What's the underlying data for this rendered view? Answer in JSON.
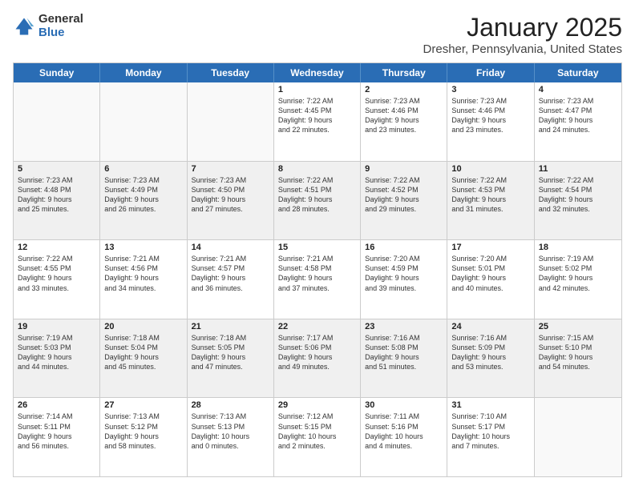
{
  "logo": {
    "general": "General",
    "blue": "Blue"
  },
  "title": "January 2025",
  "location": "Dresher, Pennsylvania, United States",
  "headers": [
    "Sunday",
    "Monday",
    "Tuesday",
    "Wednesday",
    "Thursday",
    "Friday",
    "Saturday"
  ],
  "weeks": [
    [
      {
        "day": "",
        "text": "",
        "empty": true
      },
      {
        "day": "",
        "text": "",
        "empty": true
      },
      {
        "day": "",
        "text": "",
        "empty": true
      },
      {
        "day": "1",
        "text": "Sunrise: 7:22 AM\nSunset: 4:45 PM\nDaylight: 9 hours\nand 22 minutes."
      },
      {
        "day": "2",
        "text": "Sunrise: 7:23 AM\nSunset: 4:46 PM\nDaylight: 9 hours\nand 23 minutes."
      },
      {
        "day": "3",
        "text": "Sunrise: 7:23 AM\nSunset: 4:46 PM\nDaylight: 9 hours\nand 23 minutes."
      },
      {
        "day": "4",
        "text": "Sunrise: 7:23 AM\nSunset: 4:47 PM\nDaylight: 9 hours\nand 24 minutes."
      }
    ],
    [
      {
        "day": "5",
        "text": "Sunrise: 7:23 AM\nSunset: 4:48 PM\nDaylight: 9 hours\nand 25 minutes.",
        "shaded": true
      },
      {
        "day": "6",
        "text": "Sunrise: 7:23 AM\nSunset: 4:49 PM\nDaylight: 9 hours\nand 26 minutes.",
        "shaded": true
      },
      {
        "day": "7",
        "text": "Sunrise: 7:23 AM\nSunset: 4:50 PM\nDaylight: 9 hours\nand 27 minutes.",
        "shaded": true
      },
      {
        "day": "8",
        "text": "Sunrise: 7:22 AM\nSunset: 4:51 PM\nDaylight: 9 hours\nand 28 minutes.",
        "shaded": true
      },
      {
        "day": "9",
        "text": "Sunrise: 7:22 AM\nSunset: 4:52 PM\nDaylight: 9 hours\nand 29 minutes.",
        "shaded": true
      },
      {
        "day": "10",
        "text": "Sunrise: 7:22 AM\nSunset: 4:53 PM\nDaylight: 9 hours\nand 31 minutes.",
        "shaded": true
      },
      {
        "day": "11",
        "text": "Sunrise: 7:22 AM\nSunset: 4:54 PM\nDaylight: 9 hours\nand 32 minutes.",
        "shaded": true
      }
    ],
    [
      {
        "day": "12",
        "text": "Sunrise: 7:22 AM\nSunset: 4:55 PM\nDaylight: 9 hours\nand 33 minutes."
      },
      {
        "day": "13",
        "text": "Sunrise: 7:21 AM\nSunset: 4:56 PM\nDaylight: 9 hours\nand 34 minutes."
      },
      {
        "day": "14",
        "text": "Sunrise: 7:21 AM\nSunset: 4:57 PM\nDaylight: 9 hours\nand 36 minutes."
      },
      {
        "day": "15",
        "text": "Sunrise: 7:21 AM\nSunset: 4:58 PM\nDaylight: 9 hours\nand 37 minutes."
      },
      {
        "day": "16",
        "text": "Sunrise: 7:20 AM\nSunset: 4:59 PM\nDaylight: 9 hours\nand 39 minutes."
      },
      {
        "day": "17",
        "text": "Sunrise: 7:20 AM\nSunset: 5:01 PM\nDaylight: 9 hours\nand 40 minutes."
      },
      {
        "day": "18",
        "text": "Sunrise: 7:19 AM\nSunset: 5:02 PM\nDaylight: 9 hours\nand 42 minutes."
      }
    ],
    [
      {
        "day": "19",
        "text": "Sunrise: 7:19 AM\nSunset: 5:03 PM\nDaylight: 9 hours\nand 44 minutes.",
        "shaded": true
      },
      {
        "day": "20",
        "text": "Sunrise: 7:18 AM\nSunset: 5:04 PM\nDaylight: 9 hours\nand 45 minutes.",
        "shaded": true
      },
      {
        "day": "21",
        "text": "Sunrise: 7:18 AM\nSunset: 5:05 PM\nDaylight: 9 hours\nand 47 minutes.",
        "shaded": true
      },
      {
        "day": "22",
        "text": "Sunrise: 7:17 AM\nSunset: 5:06 PM\nDaylight: 9 hours\nand 49 minutes.",
        "shaded": true
      },
      {
        "day": "23",
        "text": "Sunrise: 7:16 AM\nSunset: 5:08 PM\nDaylight: 9 hours\nand 51 minutes.",
        "shaded": true
      },
      {
        "day": "24",
        "text": "Sunrise: 7:16 AM\nSunset: 5:09 PM\nDaylight: 9 hours\nand 53 minutes.",
        "shaded": true
      },
      {
        "day": "25",
        "text": "Sunrise: 7:15 AM\nSunset: 5:10 PM\nDaylight: 9 hours\nand 54 minutes.",
        "shaded": true
      }
    ],
    [
      {
        "day": "26",
        "text": "Sunrise: 7:14 AM\nSunset: 5:11 PM\nDaylight: 9 hours\nand 56 minutes."
      },
      {
        "day": "27",
        "text": "Sunrise: 7:13 AM\nSunset: 5:12 PM\nDaylight: 9 hours\nand 58 minutes."
      },
      {
        "day": "28",
        "text": "Sunrise: 7:13 AM\nSunset: 5:13 PM\nDaylight: 10 hours\nand 0 minutes."
      },
      {
        "day": "29",
        "text": "Sunrise: 7:12 AM\nSunset: 5:15 PM\nDaylight: 10 hours\nand 2 minutes."
      },
      {
        "day": "30",
        "text": "Sunrise: 7:11 AM\nSunset: 5:16 PM\nDaylight: 10 hours\nand 4 minutes."
      },
      {
        "day": "31",
        "text": "Sunrise: 7:10 AM\nSunset: 5:17 PM\nDaylight: 10 hours\nand 7 minutes."
      },
      {
        "day": "",
        "text": "",
        "empty": true
      }
    ]
  ]
}
